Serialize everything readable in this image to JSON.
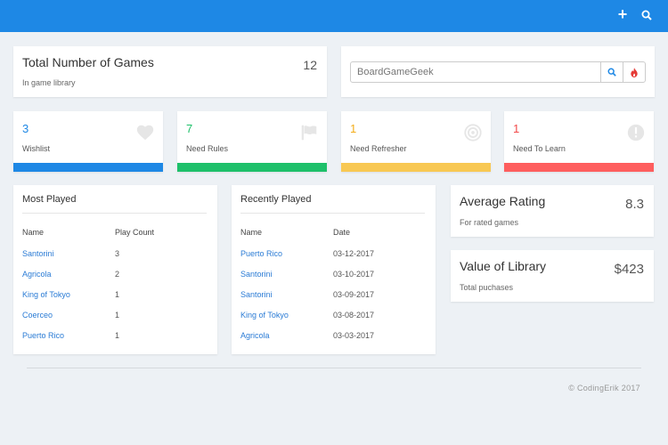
{
  "topbar": {
    "add_icon": "plus-icon",
    "search_icon": "search-icon",
    "color": "#1e88e5"
  },
  "total_games": {
    "title": "Total Number of Games",
    "value": "12",
    "subtitle": "In game library"
  },
  "search": {
    "placeholder": "BoardGameGeek",
    "search_icon": "search-icon",
    "fire_icon": "fire-icon"
  },
  "stats": [
    {
      "value": "3",
      "label": "Wishlist",
      "icon": "heart-icon",
      "color": "#1e88e5",
      "value_color": "#1e88e5"
    },
    {
      "value": "7",
      "label": "Need Rules",
      "icon": "flag-icon",
      "color": "#1ec06a",
      "value_color": "#1ec06a"
    },
    {
      "value": "1",
      "label": "Need Refresher",
      "icon": "target-icon",
      "color": "#f8c853",
      "value_color": "#f4ad1a"
    },
    {
      "value": "1",
      "label": "Need To Learn",
      "icon": "exclamation-icon",
      "color": "#fe5e5e",
      "value_color": "#f24b4b"
    }
  ],
  "most_played": {
    "title": "Most Played",
    "columns": [
      "Name",
      "Play Count"
    ],
    "rows": [
      [
        "Santorini",
        "3"
      ],
      [
        "Agricola",
        "2"
      ],
      [
        "King of Tokyo",
        "1"
      ],
      [
        "Coerceo",
        "1"
      ],
      [
        "Puerto Rico",
        "1"
      ]
    ]
  },
  "recently_played": {
    "title": "Recently Played",
    "columns": [
      "Name",
      "Date"
    ],
    "rows": [
      [
        "Puerto Rico",
        "03-12-2017"
      ],
      [
        "Santorini",
        "03-10-2017"
      ],
      [
        "Santorini",
        "03-09-2017"
      ],
      [
        "King of Tokyo",
        "03-08-2017"
      ],
      [
        "Agricola",
        "03-03-2017"
      ]
    ]
  },
  "average_rating": {
    "title": "Average Rating",
    "value": "8.3",
    "subtitle": "For rated games"
  },
  "library_value": {
    "title": "Value of Library",
    "value": "$423",
    "subtitle": "Total puchases"
  },
  "footer": {
    "text": "© CodingErik 2017"
  }
}
